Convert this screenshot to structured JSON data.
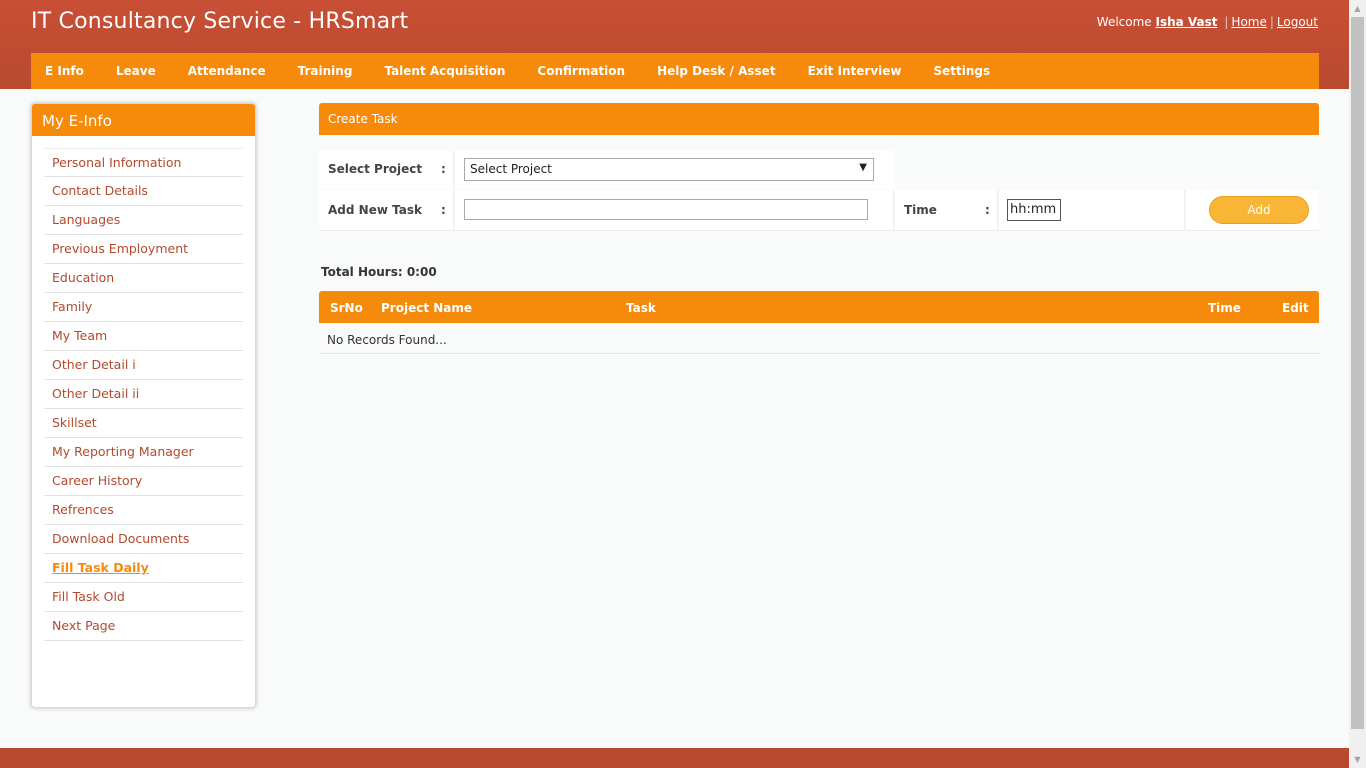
{
  "header": {
    "title": "IT Consultancy Service - HRSmart",
    "welcome_text": "Welcome",
    "user_name": "Isha Vast",
    "separator": "|",
    "home_link": "Home",
    "logout_link": "Logout"
  },
  "menu": {
    "items": [
      {
        "label": "E Info"
      },
      {
        "label": "Leave"
      },
      {
        "label": "Attendance"
      },
      {
        "label": "Training"
      },
      {
        "label": "Talent Acquisition"
      },
      {
        "label": "Confirmation"
      },
      {
        "label": "Help Desk / Asset"
      },
      {
        "label": "Exit Interview"
      },
      {
        "label": "Settings"
      }
    ]
  },
  "sidebar": {
    "title": "My E-Info",
    "items": [
      {
        "label": "Personal Information"
      },
      {
        "label": "Contact Details"
      },
      {
        "label": "Languages"
      },
      {
        "label": "Previous Employment"
      },
      {
        "label": "Education"
      },
      {
        "label": "Family"
      },
      {
        "label": "My Team"
      },
      {
        "label": "Other Detail i"
      },
      {
        "label": "Other Detail ii"
      },
      {
        "label": "Skillset"
      },
      {
        "label": "My Reporting Manager"
      },
      {
        "label": "Career History"
      },
      {
        "label": "Refrences"
      },
      {
        "label": "Download Documents"
      },
      {
        "label": "Fill Task Daily"
      },
      {
        "label": "Fill Task Old"
      },
      {
        "label": "Next Page"
      }
    ]
  },
  "create_task": {
    "title": "Create Task",
    "select_project_label": "Select Project",
    "colon": ":",
    "select_project_value": "Select Project",
    "add_task_label": "Add New Task",
    "add_task_value": "",
    "time_label": "Time",
    "time_value": "hh:mm",
    "add_button": "Add"
  },
  "summary": {
    "total_hours_text": "Total Hours: 0:00"
  },
  "task_table": {
    "columns": [
      "SrNo",
      "Project Name",
      "Task",
      "Time",
      "Edit"
    ],
    "empty_text": "No Records Found..."
  },
  "colors": {
    "header_bg": "#c84f35",
    "accent_orange": "#f58a0b",
    "button_yellow": "#f9b536",
    "sidebar_link": "#b24a2e"
  },
  "icons": {
    "select_caret": "▼",
    "scroll_up": "▲",
    "scroll_down": "▼"
  }
}
